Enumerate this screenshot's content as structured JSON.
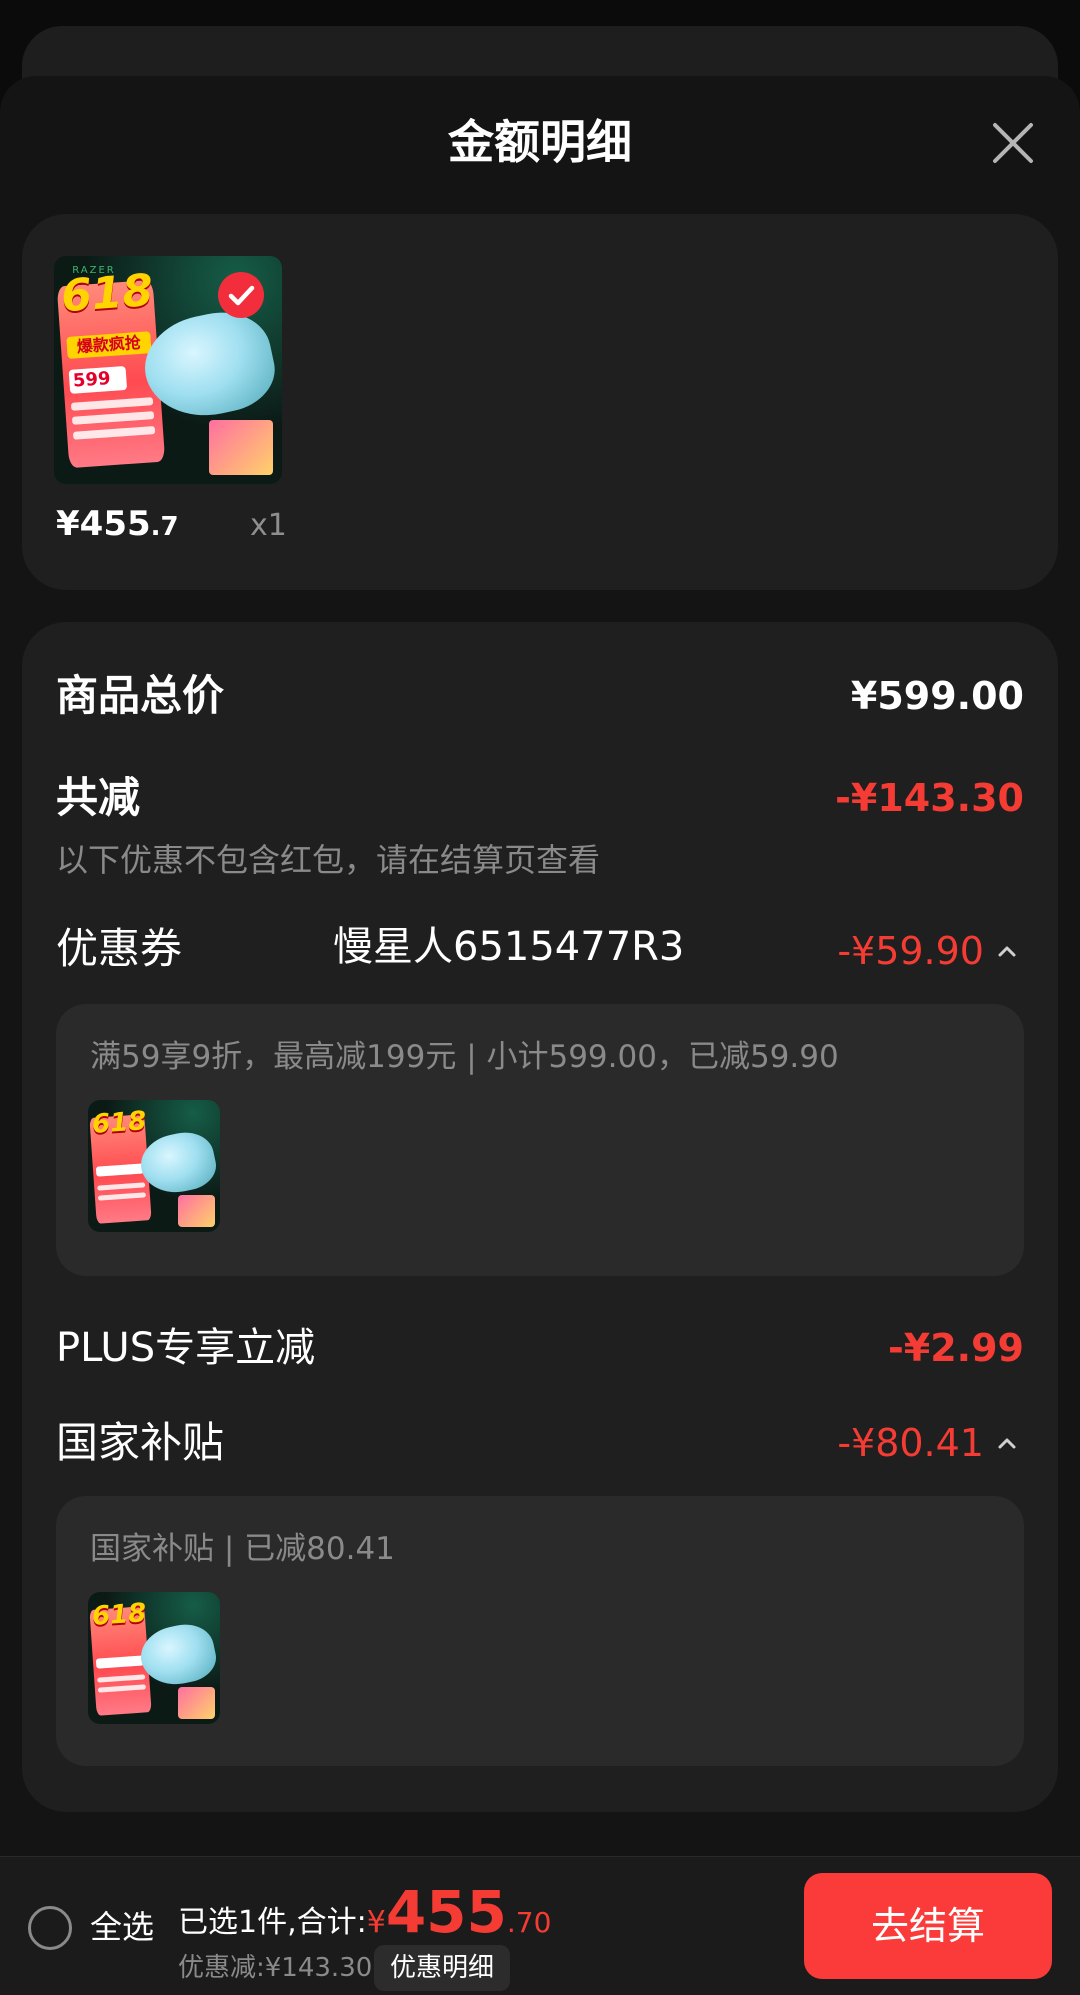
{
  "sheet": {
    "title": "金额明细"
  },
  "product": {
    "image_logo": "RAZER",
    "image_badge": "618",
    "image_tag": "爆款疯抢",
    "image_price": "599",
    "price_main": "¥455",
    "price_decimal": ".7",
    "quantity": "x1"
  },
  "details": {
    "total_label": "商品总价",
    "total_value": "¥599.00",
    "discount_label": "共减",
    "discount_value": "-¥143.30",
    "discount_hint": "以下优惠不包含红包，请在结算页查看",
    "coupon": {
      "label": "优惠券",
      "name": "慢星人6515477R3",
      "value": "-¥59.90",
      "detail": "满59享9折，最高减199元 | 小计599.00，已减59.90"
    },
    "plus": {
      "label": "PLUS专享立减",
      "value": "-¥2.99"
    },
    "subsidy": {
      "label": "国家补贴",
      "value": "-¥80.41",
      "detail": "国家补贴 | 已减80.41"
    }
  },
  "bottom_bar": {
    "select_all": "全选",
    "selected_text": "已选1件,合计:",
    "currency": "¥",
    "total_int": "455",
    "total_dec": ".70",
    "saved_text": "优惠减:¥143.30",
    "detail_link": "优惠明细",
    "checkout": "去结算"
  },
  "colors": {
    "accent_red": "#f53c34",
    "checkout_red": "#fb3a3a",
    "background": "#141414",
    "card": "#1f1f1f"
  },
  "icons": [
    "close-icon",
    "check-icon",
    "chevron-up-icon",
    "radio-unchecked-icon"
  ]
}
